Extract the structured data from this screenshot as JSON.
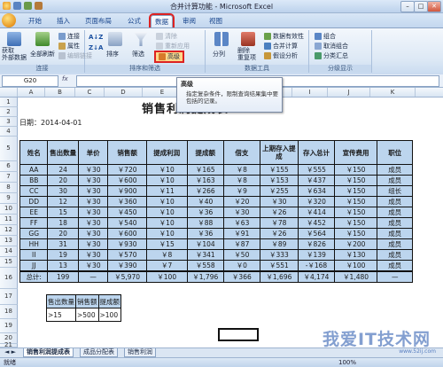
{
  "window": {
    "title": "合并计算功能 - Microsoft Excel"
  },
  "ribbon_tabs": [
    "开始",
    "插入",
    "页面布局",
    "公式",
    "数据",
    "审阅",
    "视图"
  ],
  "active_tab": "数据",
  "ribbon": {
    "get_external": "获取\n外部数据",
    "refresh_all": "全部刷新",
    "connections": "连接",
    "properties": "属性",
    "edit_links": "编辑链接",
    "sort_asc": "A↓Z",
    "sort_desc": "Z↓A",
    "sort": "排序",
    "filter": "筛选",
    "clear": "清除",
    "reapply": "重新应用",
    "advanced": "高级",
    "text_to_columns": "分列",
    "remove_duplicates": "删除\n重复项",
    "data_validation": "数据有效性",
    "consolidate": "合并计算",
    "what_if": "假设分析",
    "group": "组合",
    "ungroup": "取消组合",
    "subtotal": "分类汇总",
    "group_labels": [
      "连接",
      "排序和筛选",
      "数据工具",
      "分级显示"
    ]
  },
  "tooltip": {
    "title": "高级",
    "body": "指定复杂条件，限制查询结果集中要包括的记录。"
  },
  "formula_bar": {
    "name_box": "G20",
    "fx": "fx",
    "value": ""
  },
  "columns": [
    "A",
    "B",
    "C",
    "D",
    "E",
    "F",
    "G",
    "H",
    "I",
    "J",
    "K"
  ],
  "rows": [
    "1",
    "2",
    "3",
    "4",
    "5",
    "6",
    "7",
    "8",
    "9",
    "10",
    "11",
    "12",
    "13",
    "14",
    "15",
    "16",
    "17",
    "18",
    "19",
    "20",
    "21"
  ],
  "sheet": {
    "title": "销售利润提成表",
    "date": "日期：2014-04-01",
    "headers": [
      "姓名",
      "售出数量",
      "单价",
      "销售额",
      "提成利润",
      "提成额",
      "借支",
      "上期存入提成",
      "存入总计",
      "宣传费用",
      "职位"
    ],
    "rows": [
      [
        "AA",
        "24",
        "￥30",
        "￥720",
        "￥10",
        "￥165",
        "￥8",
        "￥155",
        "￥555",
        "￥150",
        "成员"
      ],
      [
        "BB",
        "20",
        "￥30",
        "￥600",
        "￥10",
        "￥163",
        "￥8",
        "￥153",
        "￥437",
        "￥150",
        "成员"
      ],
      [
        "CC",
        "30",
        "￥30",
        "￥900",
        "￥11",
        "￥266",
        "￥9",
        "￥255",
        "￥634",
        "￥150",
        "组长"
      ],
      [
        "DD",
        "12",
        "￥30",
        "￥360",
        "￥10",
        "￥40",
        "￥20",
        "￥30",
        "￥320",
        "￥150",
        "成员"
      ],
      [
        "EE",
        "15",
        "￥30",
        "￥450",
        "￥10",
        "￥36",
        "￥30",
        "￥26",
        "￥414",
        "￥150",
        "成员"
      ],
      [
        "FF",
        "18",
        "￥30",
        "￥540",
        "￥10",
        "￥88",
        "￥63",
        "￥78",
        "￥452",
        "￥150",
        "成员"
      ],
      [
        "GG",
        "20",
        "￥30",
        "￥600",
        "￥10",
        "￥36",
        "￥91",
        "￥26",
        "￥564",
        "￥150",
        "成员"
      ],
      [
        "HH",
        "31",
        "￥30",
        "￥930",
        "￥15",
        "￥104",
        "￥87",
        "￥89",
        "￥826",
        "￥200",
        "成员"
      ],
      [
        "II",
        "19",
        "￥30",
        "￥570",
        "￥8",
        "￥341",
        "￥50",
        "￥333",
        "￥139",
        "￥130",
        "成员"
      ],
      [
        "JJ",
        "13",
        "￥30",
        "￥390",
        "￥7",
        "￥558",
        "￥0",
        "￥551",
        "-￥168",
        "￥100",
        "成员"
      ]
    ],
    "total": [
      "总计:",
      "199",
      "—",
      "￥5,970",
      "￥100",
      "￥1,796",
      "￥366",
      "￥1,696",
      "￥4,174",
      "￥1,480",
      "—"
    ],
    "criteria_headers": [
      "售出数量",
      "销售额",
      "提成额"
    ],
    "criteria_values": [
      ">15",
      ">500",
      ">100"
    ]
  },
  "sheet_tabs": [
    "销售利润提成表",
    "成品分配表",
    "销售利润"
  ],
  "status": {
    "ready": "就绪",
    "zoom": "100%"
  },
  "watermark": {
    "text": "我爱IT技术网",
    "url": "www.52ij.com"
  },
  "colors": {
    "header_fill": "#bcd5ee",
    "highlight": "#dd2222",
    "ribbon": "#dce8f5"
  }
}
